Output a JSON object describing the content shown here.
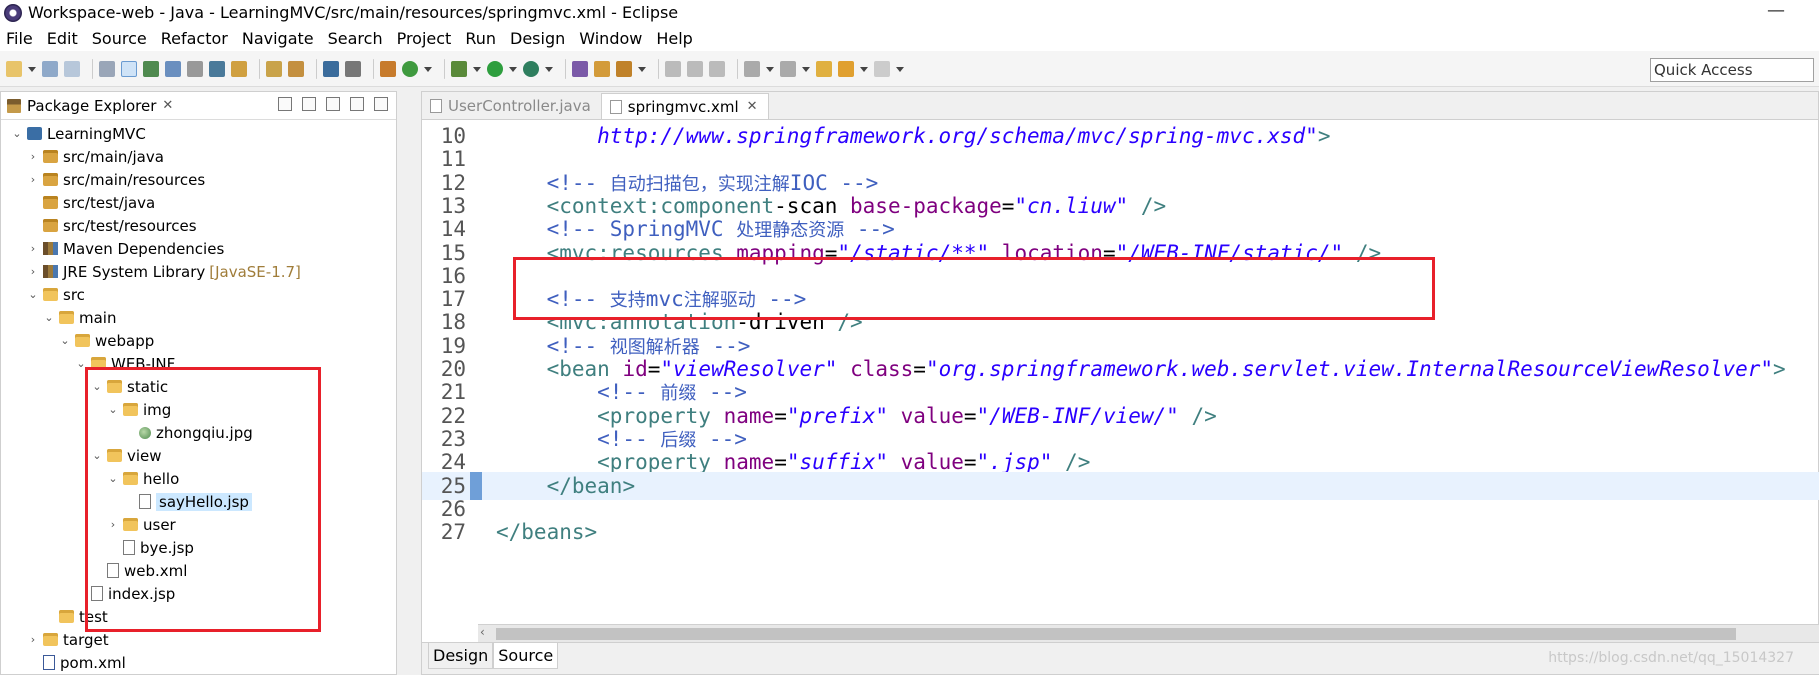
{
  "window": {
    "title": "Workspace-web - Java - LearningMVC/src/main/resources/springmvc.xml - Eclipse",
    "minimize_glyph": "—"
  },
  "menu": {
    "items": [
      "File",
      "Edit",
      "Source",
      "Refactor",
      "Navigate",
      "Search",
      "Project",
      "Run",
      "Design",
      "Window",
      "Help"
    ]
  },
  "toolbar": {
    "quick_access_label": "Quick Access"
  },
  "package_explorer": {
    "tab_label": "Package Explorer",
    "close_glyph": "✕",
    "tree": [
      {
        "label": "LearningMVC",
        "twisty": "⌄",
        "icon": "project-icon"
      },
      {
        "label": "src/main/java",
        "twisty": "›",
        "icon": "source-folder-icon"
      },
      {
        "label": "src/main/resources",
        "twisty": "›",
        "icon": "source-folder-icon"
      },
      {
        "label": "src/test/java",
        "twisty": "",
        "icon": "source-folder-icon"
      },
      {
        "label": "src/test/resources",
        "twisty": "",
        "icon": "source-folder-icon"
      },
      {
        "label": "Maven Dependencies",
        "twisty": "›",
        "icon": "library-icon"
      },
      {
        "label": "JRE System Library",
        "decor": "[JavaSE-1.7]",
        "twisty": "›",
        "icon": "library-icon"
      },
      {
        "label": "src",
        "twisty": "⌄",
        "icon": "folder-icon"
      },
      {
        "label": "main",
        "twisty": "⌄",
        "icon": "folder-icon"
      },
      {
        "label": "webapp",
        "twisty": "⌄",
        "icon": "folder-icon"
      },
      {
        "label": "WEB-INF",
        "twisty": "⌄",
        "icon": "folder-icon"
      },
      {
        "label": "static",
        "twisty": "⌄",
        "icon": "folder-icon"
      },
      {
        "label": "img",
        "twisty": "⌄",
        "icon": "folder-icon"
      },
      {
        "label": "zhongqiu.jpg",
        "twisty": "",
        "icon": "image-file-icon"
      },
      {
        "label": "view",
        "twisty": "⌄",
        "icon": "folder-icon"
      },
      {
        "label": "hello",
        "twisty": "⌄",
        "icon": "folder-icon"
      },
      {
        "label": "sayHello.jsp",
        "twisty": "",
        "icon": "jsp-file-icon",
        "selected": true
      },
      {
        "label": "user",
        "twisty": "›",
        "icon": "folder-icon"
      },
      {
        "label": "bye.jsp",
        "twisty": "",
        "icon": "jsp-file-icon"
      },
      {
        "label": "web.xml",
        "twisty": "",
        "icon": "xml-file-icon"
      },
      {
        "label": "index.jsp",
        "twisty": "",
        "icon": "jsp-file-icon"
      },
      {
        "label": "test",
        "twisty": "",
        "icon": "folder-icon"
      },
      {
        "label": "target",
        "twisty": "›",
        "icon": "folder-icon"
      },
      {
        "label": "pom.xml",
        "twisty": "",
        "icon": "maven-pom-icon"
      }
    ]
  },
  "editor": {
    "tabs": [
      {
        "label": "UserController.java",
        "active": false
      },
      {
        "label": "springmvc.xml",
        "active": true
      }
    ],
    "lines": [
      {
        "n": "10",
        "html": "url",
        "text": "        http://www.springframework.org/schema/mvc/spring-mvc.xsd\">"
      },
      {
        "n": "11",
        "text": ""
      },
      {
        "n": "12",
        "text": "    <!-- 自动扫描包，实现注解IOC -->"
      },
      {
        "n": "13",
        "text": "    <context:component-scan base-package=\"cn.liuw\" />"
      },
      {
        "n": "14",
        "text": "    <!-- SpringMVC 处理静态资源 -->"
      },
      {
        "n": "15",
        "text": "    <mvc:resources mapping=\"/static/**\" location=\"/WEB-INF/static/\" />"
      },
      {
        "n": "16",
        "text": ""
      },
      {
        "n": "17",
        "text": "    <!-- 支持mvc注解驱动 -->"
      },
      {
        "n": "18",
        "text": "    <mvc:annotation-driven />"
      },
      {
        "n": "19",
        "text": "    <!-- 视图解析器 -->"
      },
      {
        "n": "20",
        "text": "    <bean id=\"viewResolver\" class=\"org.springframework.web.servlet.view.InternalResourceViewResolver\">"
      },
      {
        "n": "21",
        "text": "        <!-- 前缀 -->"
      },
      {
        "n": "22",
        "text": "        <property name=\"prefix\" value=\"/WEB-INF/view/\" />"
      },
      {
        "n": "23",
        "text": "        <!-- 后缀 -->"
      },
      {
        "n": "24",
        "text": "        <property name=\"suffix\" value=\".jsp\" />"
      },
      {
        "n": "25",
        "text": "    </bean>"
      },
      {
        "n": "26",
        "text": ""
      },
      {
        "n": "27",
        "text": "</beans>"
      }
    ],
    "bottom_tabs": [
      "Design",
      "Source"
    ],
    "watermark": "https://blog.csdn.net/qq_15014327"
  }
}
